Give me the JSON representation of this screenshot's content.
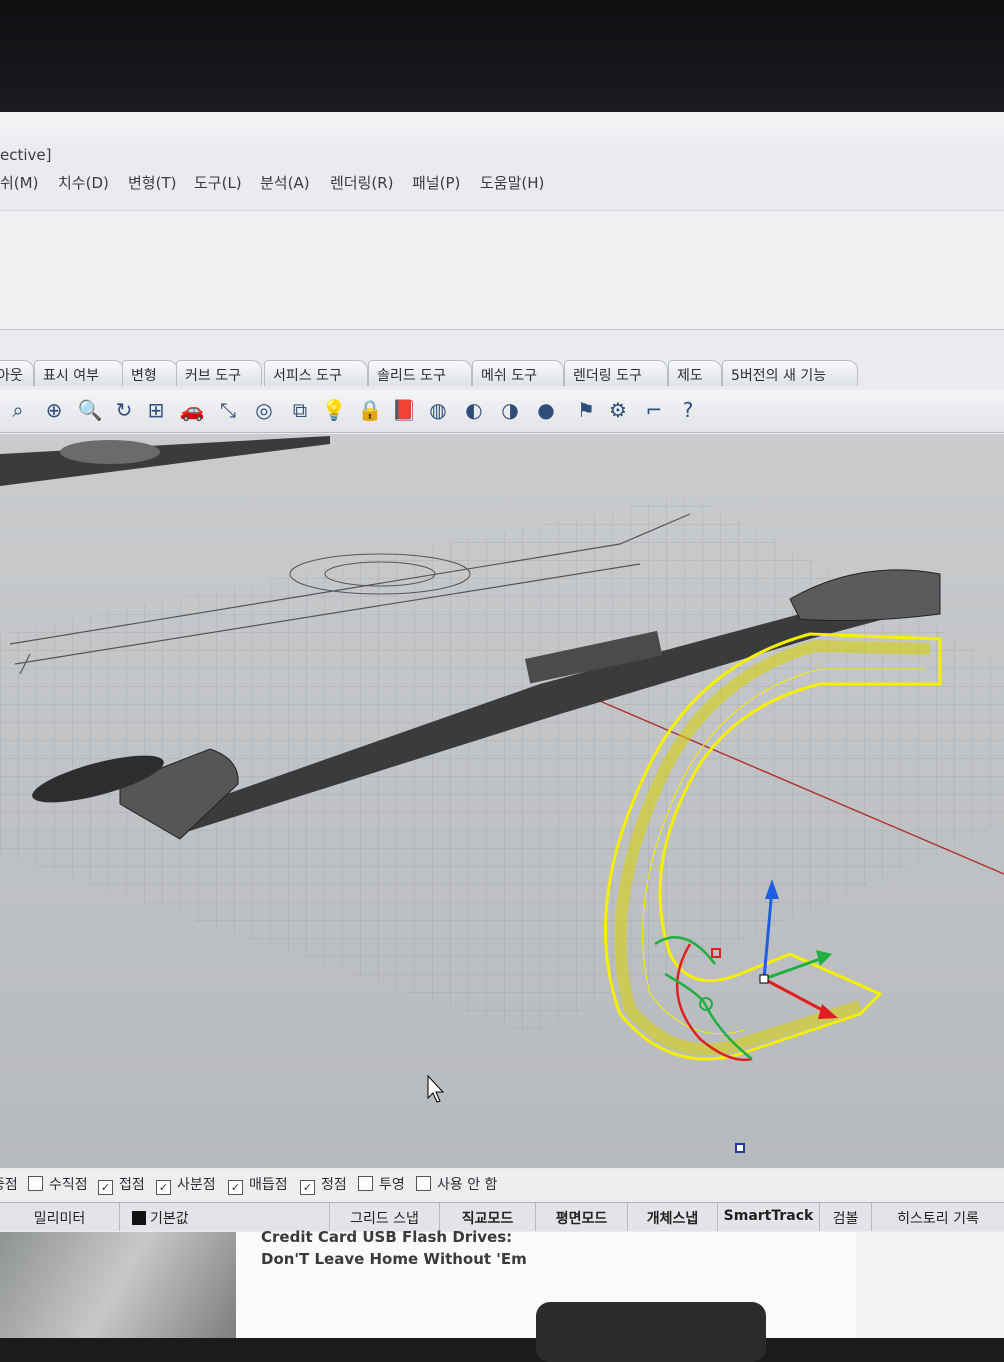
{
  "window": {
    "title_fragment": "ective]"
  },
  "menu": [
    {
      "label": "쉬(M)"
    },
    {
      "label": "치수(D)"
    },
    {
      "label": "변형(T)"
    },
    {
      "label": "도구(L)"
    },
    {
      "label": "분석(A)"
    },
    {
      "label": "렌더링(R)"
    },
    {
      "label": "패널(P)"
    },
    {
      "label": "도움말(H)"
    }
  ],
  "toolbar_tabs": [
    {
      "label": "아웃"
    },
    {
      "label": "표시 여부"
    },
    {
      "label": "변형"
    },
    {
      "label": "커브 도구"
    },
    {
      "label": "서피스 도구"
    },
    {
      "label": "솔리드 도구"
    },
    {
      "label": "메쉬 도구"
    },
    {
      "label": "렌더링 도구"
    },
    {
      "label": "제도"
    },
    {
      "label": "5버전의 새 기능"
    }
  ],
  "tools": [
    {
      "icon": "lasso-zoom-icon",
      "glyph": "⌕"
    },
    {
      "icon": "zoom-extents-icon",
      "glyph": "⊕"
    },
    {
      "icon": "zoom-window-icon",
      "glyph": "🔍"
    },
    {
      "icon": "rotate-view-icon",
      "glyph": "↻"
    },
    {
      "icon": "four-viewports-icon",
      "glyph": "⊞"
    },
    {
      "icon": "car-render-icon",
      "glyph": "🚗"
    },
    {
      "icon": "select-icon",
      "glyph": "⤡"
    },
    {
      "icon": "circle-tool-icon",
      "glyph": "◎"
    },
    {
      "icon": "transform-icon",
      "glyph": "⧉"
    },
    {
      "icon": "light-bulb-icon",
      "glyph": "💡"
    },
    {
      "icon": "lock-icon",
      "glyph": "🔒"
    },
    {
      "icon": "material-book-icon",
      "glyph": "📕"
    },
    {
      "icon": "color-wheel-icon",
      "glyph": "◍"
    },
    {
      "icon": "shaded-sphere-icon",
      "glyph": "◐"
    },
    {
      "icon": "rendered-sphere-icon",
      "glyph": "◑"
    },
    {
      "icon": "blue-sphere-icon",
      "glyph": "●"
    },
    {
      "icon": "flag-icon",
      "glyph": "⚑"
    },
    {
      "icon": "gear-icon",
      "glyph": "⚙"
    },
    {
      "icon": "dimension-icon",
      "glyph": "⌐"
    },
    {
      "icon": "help-icon",
      "glyph": "?"
    }
  ],
  "osnap": [
    {
      "label": "중점",
      "checked": false,
      "partial": true
    },
    {
      "label": "수직점",
      "checked": false
    },
    {
      "label": "접점",
      "checked": true
    },
    {
      "label": "사분점",
      "checked": true
    },
    {
      "label": "매듭점",
      "checked": true
    },
    {
      "label": "정점",
      "checked": true
    },
    {
      "label": "투영",
      "checked": false
    },
    {
      "label": "사용 안 함",
      "checked": false
    }
  ],
  "status": {
    "units": "밀리미터",
    "layer": "기본값",
    "grid_snap": "그리드 스냅",
    "ortho": "직교모드",
    "planar": "평면모드",
    "osnap": "개체스냅",
    "smarttrack": "SmartTrack",
    "gumball": "검볼",
    "history": "히스토리 기록"
  },
  "background_page": {
    "line1": "Credit Card USB Flash Drives:",
    "line2": "Don'T Leave Home Without 'Em"
  },
  "colors": {
    "selection_yellow": "#f5f000",
    "axis_red": "#e02020",
    "axis_green": "#20b040",
    "axis_blue": "#1e5fe0",
    "model_dark": "#3a3b3d"
  }
}
